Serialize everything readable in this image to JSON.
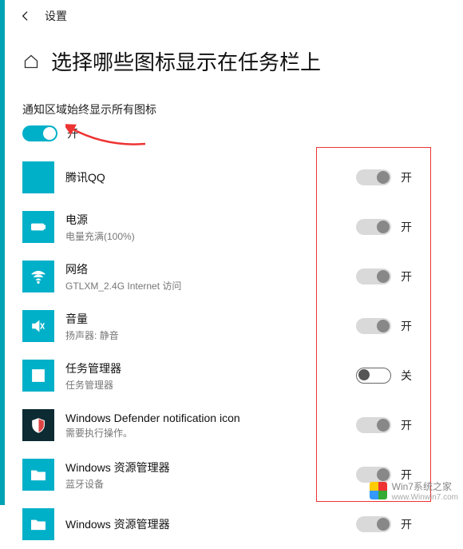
{
  "colors": {
    "accent": "#00b0c8"
  },
  "header": {
    "back_icon": "arrow-left",
    "title": "设置"
  },
  "page": {
    "home_icon": "home",
    "title": "选择哪些图标显示在任务栏上"
  },
  "section": {
    "label": "通知区域始终显示所有图标",
    "master_toggle": {
      "state": "on",
      "label": "开"
    }
  },
  "labels": {
    "on": "开",
    "off": "关"
  },
  "items": [
    {
      "icon": "qq",
      "title": "腾讯QQ",
      "subtitle": "",
      "state": "on",
      "toggle_style": "grey"
    },
    {
      "icon": "battery",
      "title": "电源",
      "subtitle": "电量充满(100%)",
      "state": "on",
      "toggle_style": "grey"
    },
    {
      "icon": "wifi",
      "title": "网络",
      "subtitle": "GTLXM_2.4G Internet 访问",
      "state": "on",
      "toggle_style": "grey"
    },
    {
      "icon": "volume",
      "title": "音量",
      "subtitle": "扬声器: 静音",
      "state": "on",
      "toggle_style": "grey"
    },
    {
      "icon": "task",
      "title": "任务管理器",
      "subtitle": "任务管理器",
      "state": "off",
      "toggle_style": "outline"
    },
    {
      "icon": "shield",
      "title": "Windows Defender notification icon",
      "subtitle": "需要执行操作。",
      "state": "on",
      "toggle_style": "grey"
    },
    {
      "icon": "explorer",
      "title": "Windows 资源管理器",
      "subtitle": "蓝牙设备",
      "state": "on",
      "toggle_style": "grey"
    },
    {
      "icon": "explorer",
      "title": "Windows 资源管理器",
      "subtitle": "",
      "state": "on",
      "toggle_style": "grey"
    }
  ],
  "watermark": {
    "line1": "Win7系统之家",
    "line2": "www.Winwin7.com"
  }
}
